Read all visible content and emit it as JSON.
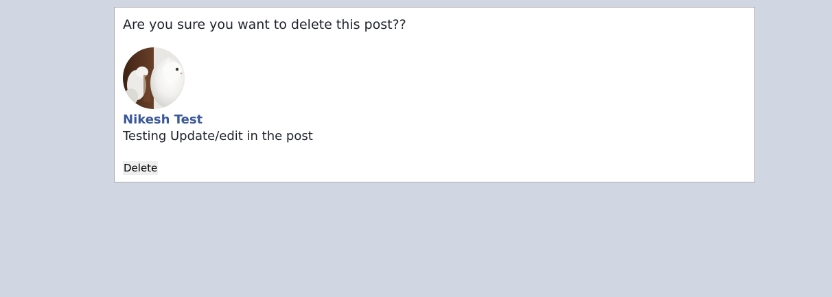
{
  "dialog": {
    "prompt": "Are you sure you want to delete this post??",
    "post": {
      "author": "Nikesh Test",
      "text": "Testing Update/edit in the post",
      "avatar": "profile-photo-of-white-cats"
    },
    "delete_label": "Delete"
  },
  "colors": {
    "background": "#d1d7e2",
    "card": "#ffffff",
    "author_link": "#3b5998",
    "text": "#1d2129"
  }
}
